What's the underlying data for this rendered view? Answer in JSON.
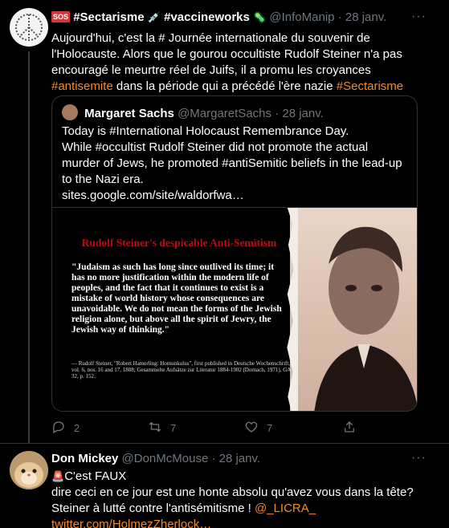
{
  "tweet1": {
    "name_hashtag1": "#Sectarisme",
    "name_hashtag2": "#vaccineworks",
    "handle": "@InfoManip",
    "time": "28 janv.",
    "text_part1": "Aujourd'hui, c'est la # Journée internationale du souvenir de l'Holocauste. Alors que le gourou occultiste Rudolf Steiner n'a pas encouragé le meurtre réel de Juifs, il a promu les croyances ",
    "hashtag_antisemite": "#antisemite",
    "text_part2": " dans la période qui a précédé l'ère nazie ",
    "hashtag_sectarisme": "#Sectarisme",
    "quoted": {
      "name": "Margaret Sachs",
      "handle": "@MargaretSachs",
      "time": "28 janv.",
      "line1": "Today is #International Holocaust Remembrance Day.",
      "line2": "While #occultist Rudolf Steiner did not promote the actual murder of Jews, he promoted #antiSemitic beliefs in the lead-up to the Nazi era.",
      "url": "sites.google.com/site/waldorfwa…",
      "image_title": "Rudolf Steiner's despicable Anti-Semitism",
      "image_quote": "\"Judaism as such has long since outlived its time; it has no more justification within the modern life of peoples, and the fact that it continues to exist is a mistake of world history whose consequences are unavoidable. We do not mean the forms of the Jewish religion alone, but above all the spirit of Jewry, the Jewish way of thinking.\"",
      "image_cite": "— Rudolf Steiner, \"Robert Hamerling: Homunkulus\", first published in Deutsche Wochenschrift, vol. 6, nos. 16 and 17, 1888; Gesammelte Aufsätze zur Literatur 1884-1902 (Dornach, 1971), GA 32, p. 152."
    },
    "replies": "2",
    "retweets": "7",
    "likes": "7"
  },
  "tweet2": {
    "name": "Don Mickey",
    "handle": "@DonMcMouse",
    "time": "28 janv.",
    "line1": "C'est FAUX",
    "line2": "dire ceci en ce jour est une honte absolu qu'avez vous dans la tête?",
    "line3a": "Steiner à lutté contre l'antisémitisme ! ",
    "mention": "@_LICRA_",
    "link": "twitter.com/HolmezZherlock…"
  },
  "more_label": "···"
}
